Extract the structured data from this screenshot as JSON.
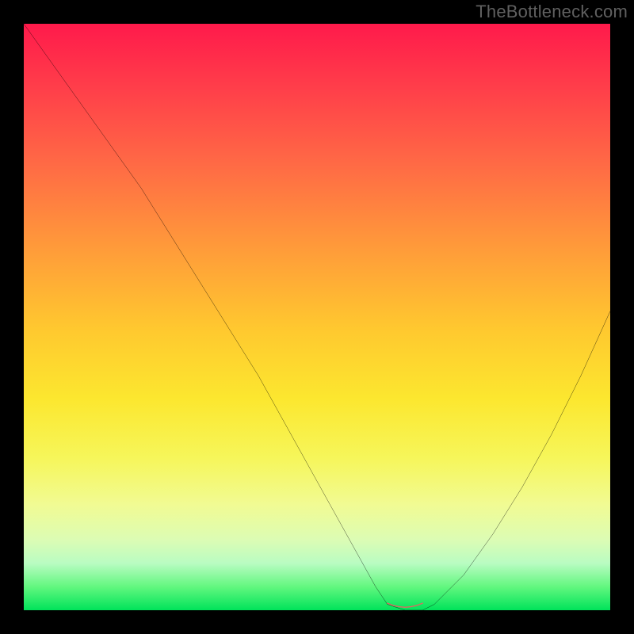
{
  "watermark": "TheBottleneck.com",
  "chart_data": {
    "type": "line",
    "title": "",
    "xlabel": "",
    "ylabel": "",
    "xlim": [
      0,
      100
    ],
    "ylim": [
      0,
      100
    ],
    "series": [
      {
        "name": "bottleneck-curve",
        "x": [
          0,
          5,
          10,
          15,
          20,
          25,
          30,
          35,
          40,
          45,
          50,
          55,
          60,
          62,
          65,
          68,
          70,
          75,
          80,
          85,
          90,
          95,
          100
        ],
        "values": [
          100,
          93,
          86,
          79,
          72,
          64,
          56,
          48,
          40,
          31,
          22,
          13,
          4,
          1,
          0,
          0,
          1,
          6,
          13,
          21,
          30,
          40,
          51
        ]
      },
      {
        "name": "optimum-marker",
        "x": [
          62,
          63,
          64,
          65,
          66,
          67,
          68
        ],
        "values": [
          1.2,
          0.8,
          0.6,
          0.5,
          0.6,
          0.8,
          1.2
        ]
      }
    ],
    "gradient_stops": [
      {
        "pos": 0,
        "color": "#ff1a4b"
      },
      {
        "pos": 10,
        "color": "#ff3b4a"
      },
      {
        "pos": 24,
        "color": "#ff6a45"
      },
      {
        "pos": 38,
        "color": "#ff9a3a"
      },
      {
        "pos": 52,
        "color": "#ffc82f"
      },
      {
        "pos": 64,
        "color": "#fce72f"
      },
      {
        "pos": 74,
        "color": "#f6f65a"
      },
      {
        "pos": 82,
        "color": "#f1fb93"
      },
      {
        "pos": 88,
        "color": "#dcfcb4"
      },
      {
        "pos": 92,
        "color": "#b9fcc2"
      },
      {
        "pos": 96,
        "color": "#62f77f"
      },
      {
        "pos": 100,
        "color": "#00e35a"
      }
    ],
    "colors": {
      "curve": "#000000",
      "marker": "#d86b62",
      "background_frame": "#000000"
    }
  }
}
